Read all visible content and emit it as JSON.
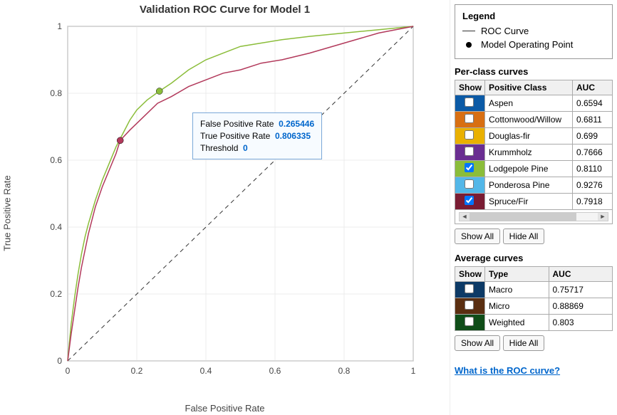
{
  "chart_data": {
    "type": "line",
    "title": "Validation ROC Curve for Model 1",
    "xlabel": "False Positive Rate",
    "ylabel": "True Positive Rate",
    "xlim": [
      0,
      1
    ],
    "ylim": [
      0,
      1
    ],
    "xticks": [
      0,
      0.2,
      0.4,
      0.6,
      0.8,
      1
    ],
    "yticks": [
      0,
      0.2,
      0.4,
      0.6,
      0.8,
      1
    ],
    "series": [
      {
        "name": "Lodgepole Pine",
        "color": "#8bbd3a",
        "values": [
          [
            0,
            0
          ],
          [
            0.01,
            0.11
          ],
          [
            0.02,
            0.19
          ],
          [
            0.03,
            0.26
          ],
          [
            0.04,
            0.32
          ],
          [
            0.05,
            0.37
          ],
          [
            0.06,
            0.41
          ],
          [
            0.08,
            0.48
          ],
          [
            0.1,
            0.54
          ],
          [
            0.12,
            0.59
          ],
          [
            0.14,
            0.64
          ],
          [
            0.16,
            0.68
          ],
          [
            0.18,
            0.72
          ],
          [
            0.2,
            0.75
          ],
          [
            0.23,
            0.78
          ],
          [
            0.265446,
            0.806335
          ],
          [
            0.3,
            0.83
          ],
          [
            0.35,
            0.87
          ],
          [
            0.4,
            0.9
          ],
          [
            0.45,
            0.92
          ],
          [
            0.5,
            0.94
          ],
          [
            0.56,
            0.95
          ],
          [
            0.62,
            0.96
          ],
          [
            0.7,
            0.97
          ],
          [
            0.8,
            0.98
          ],
          [
            0.9,
            0.99
          ],
          [
            1.0,
            1.0
          ]
        ],
        "op_point": [
          0.265446,
          0.806335
        ]
      },
      {
        "name": "Spruce/Fir",
        "color": "#b2395b",
        "values": [
          [
            0,
            0
          ],
          [
            0.01,
            0.08
          ],
          [
            0.02,
            0.15
          ],
          [
            0.03,
            0.22
          ],
          [
            0.04,
            0.28
          ],
          [
            0.05,
            0.33
          ],
          [
            0.06,
            0.38
          ],
          [
            0.08,
            0.46
          ],
          [
            0.1,
            0.52
          ],
          [
            0.12,
            0.57
          ],
          [
            0.14,
            0.62
          ],
          [
            0.152,
            0.659
          ],
          [
            0.18,
            0.69
          ],
          [
            0.22,
            0.73
          ],
          [
            0.26,
            0.77
          ],
          [
            0.3,
            0.79
          ],
          [
            0.35,
            0.82
          ],
          [
            0.4,
            0.84
          ],
          [
            0.45,
            0.86
          ],
          [
            0.5,
            0.87
          ],
          [
            0.56,
            0.89
          ],
          [
            0.62,
            0.9
          ],
          [
            0.7,
            0.92
          ],
          [
            0.8,
            0.95
          ],
          [
            0.9,
            0.98
          ],
          [
            1.0,
            1.0
          ]
        ],
        "op_point": [
          0.152,
          0.659
        ]
      }
    ],
    "diagonal": true,
    "tooltip": {
      "fpr_label": "False Positive Rate",
      "fpr_value": "0.265446",
      "tpr_label": "True Positive Rate",
      "tpr_value": "0.806335",
      "thresh_label": "Threshold",
      "thresh_value": "0"
    }
  },
  "legend": {
    "title": "Legend",
    "roc": "ROC Curve",
    "op": "Model Operating Point"
  },
  "per_class": {
    "title": "Per-class curves",
    "headers": {
      "show": "Show",
      "class": "Positive Class",
      "auc": "AUC"
    },
    "rows": [
      {
        "checked": false,
        "color": "#0b5aa6",
        "name": "Aspen",
        "auc": "0.6594"
      },
      {
        "checked": false,
        "color": "#d86f12",
        "name": "Cottonwood/Willow",
        "auc": "0.6811"
      },
      {
        "checked": false,
        "color": "#e9b000",
        "name": "Douglas-fir",
        "auc": "0.699"
      },
      {
        "checked": false,
        "color": "#6a2e91",
        "name": "Krummholz",
        "auc": "0.7666"
      },
      {
        "checked": true,
        "color": "#8bbd3a",
        "name": "Lodgepole Pine",
        "auc": "0.8110"
      },
      {
        "checked": false,
        "color": "#53b7e8",
        "name": "Ponderosa Pine",
        "auc": "0.9276"
      },
      {
        "checked": true,
        "color": "#7a1c33",
        "name": "Spruce/Fir",
        "auc": "0.7918"
      }
    ]
  },
  "average": {
    "title": "Average curves",
    "headers": {
      "show": "Show",
      "type": "Type",
      "auc": "AUC"
    },
    "rows": [
      {
        "checked": false,
        "color": "#0d3a66",
        "name": "Macro",
        "auc": "0.75717"
      },
      {
        "checked": false,
        "color": "#5a2e10",
        "name": "Micro",
        "auc": "0.88869"
      },
      {
        "checked": false,
        "color": "#0f4d18",
        "name": "Weighted",
        "auc": "0.803"
      }
    ]
  },
  "buttons": {
    "show_all": "Show All",
    "hide_all": "Hide All"
  },
  "help_link": "What is the ROC curve?"
}
